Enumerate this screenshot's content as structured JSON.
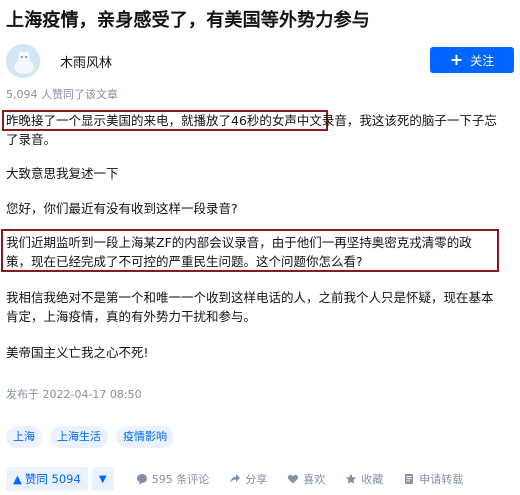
{
  "article": {
    "title": "上海疫情，亲身感受了，有美国等外势力参与",
    "vote_summary": "5,094 人赞同了该文章",
    "paragraphs": {
      "p1_hl": "昨晚接了一个显示美国的来电，就播放了46秒的女声中文录音，",
      "p1_rest": "我这该死的脑子一下子忘了录音。",
      "p2": "大致意思我复述一下",
      "p3": "您好，你们最近有没有收到这样一段录音?",
      "p4": "我们近期监听到一段上海某ZF的内部会议录音，由于他们一再坚持奥密克戎清零的政策，现在已经完成了不可控的严重民生问题。这个问题你怎么看?",
      "p5": "我相信我绝对不是第一个和唯一一个收到这样电话的人，之前我个人只是怀疑，现在基本肯定，上海疫情，真的有外势力干扰和参与。",
      "p6": "美帝国主义亡我之心不死!"
    },
    "published": "发布于 2022-04-17 08:50",
    "tags": [
      "上海",
      "上海生活",
      "疫情影响"
    ]
  },
  "author": {
    "name": "木雨风林",
    "follow_label": "关注"
  },
  "footer": {
    "upvote_label": "赞同 5094",
    "comments_label": "595 条评论",
    "share_label": "分享",
    "like_label": "喜欢",
    "collect_label": "收藏",
    "reprint_label": "申请转载"
  },
  "colors": {
    "brand_blue": "#0066ff",
    "highlight_border": "#8b1a1a",
    "muted_text": "#8590a6"
  }
}
